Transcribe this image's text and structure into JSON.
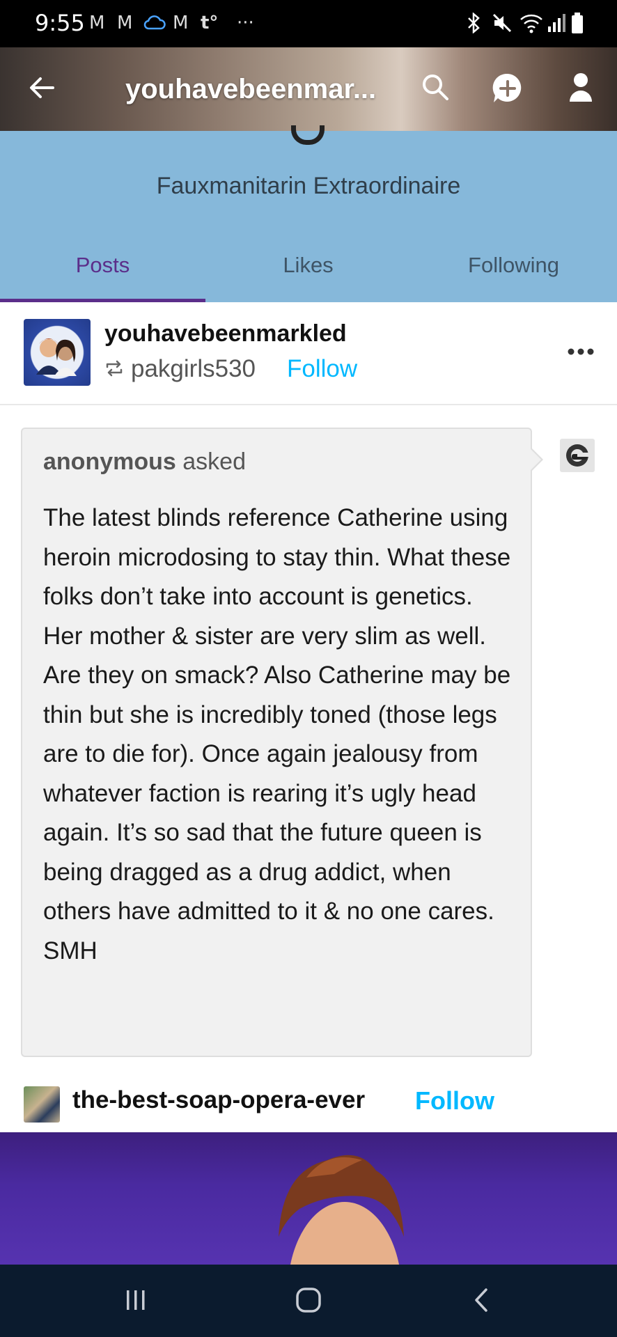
{
  "status_bar": {
    "time": "9:55",
    "left_icons": [
      "gmail-icon",
      "gmail-icon",
      "cloud-icon",
      "gmail-icon",
      "tumblr-icon",
      "more-dots-icon"
    ],
    "right_icons": [
      "bluetooth-icon",
      "mute-icon",
      "wifi-icon",
      "signal-icon",
      "battery-icon"
    ]
  },
  "header": {
    "title": "youhavebeenmar...",
    "back_icon": "arrow-left-icon",
    "search_icon": "search-icon",
    "compose_icon": "plus-bubble-icon",
    "account_icon": "person-icon"
  },
  "blog": {
    "description": "Fauxmanitarin Extraordinaire",
    "tabs": [
      {
        "label": "Posts",
        "active": true
      },
      {
        "label": "Likes",
        "active": false
      },
      {
        "label": "Following",
        "active": false
      }
    ]
  },
  "post": {
    "blog_name": "youhavebeenmarkled",
    "reblogged_from": "pakgirls530",
    "follow_label": "Follow",
    "more_icon": "more-horizontal-icon",
    "ask": {
      "asker": "anonymous",
      "asked_label": "asked",
      "question": "The latest blinds reference Catherine using heroin microdosing to stay thin. What these folks don’t take into account is genetics. Her mother & sister are very slim as well. Are they on smack? Also Catherine may be thin but she is incredibly toned (those legs are to die for). Once again jealousy from whatever faction is rearing it’s ugly head again. It’s so sad that the future queen is being dragged as a drug addict, when others have admitted to it & no one cares. SMH",
      "anon_avatar_icon": "sunglasses-anon-icon"
    },
    "reblog": {
      "blog_name": "the-best-soap-opera-ever",
      "follow_label": "Follow"
    }
  },
  "nav_bar": {
    "icons": [
      "recent-apps-icon",
      "home-icon",
      "back-icon"
    ]
  },
  "colors": {
    "banner": "#86b8da",
    "active_tab": "#5b2e8a",
    "follow": "#00b8ff",
    "navbar": "#0b1b2e"
  }
}
